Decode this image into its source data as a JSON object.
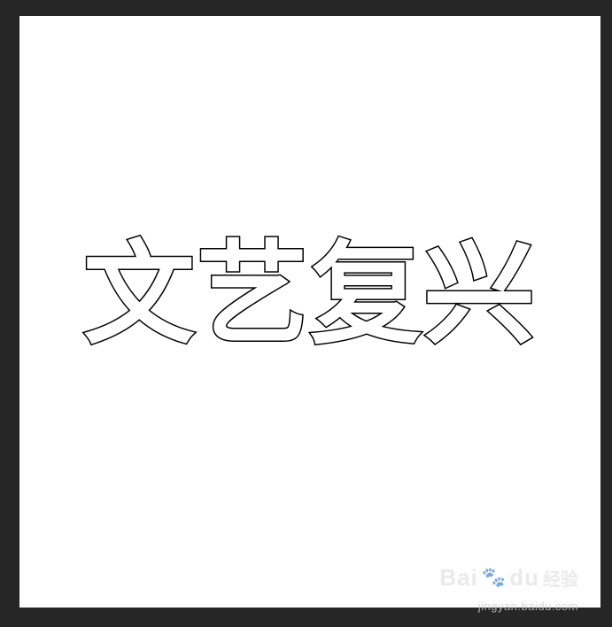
{
  "canvas": {
    "text": "文艺复兴"
  },
  "watermark": {
    "brand": "Bai",
    "brand_tail": "du",
    "paw_icon": "paw-icon",
    "cn": "经验",
    "url": "jingyan.baidu.com"
  },
  "colors": {
    "background": "#262626",
    "canvas": "#ffffff",
    "stroke": "#000000",
    "fill": "#ffffff"
  }
}
